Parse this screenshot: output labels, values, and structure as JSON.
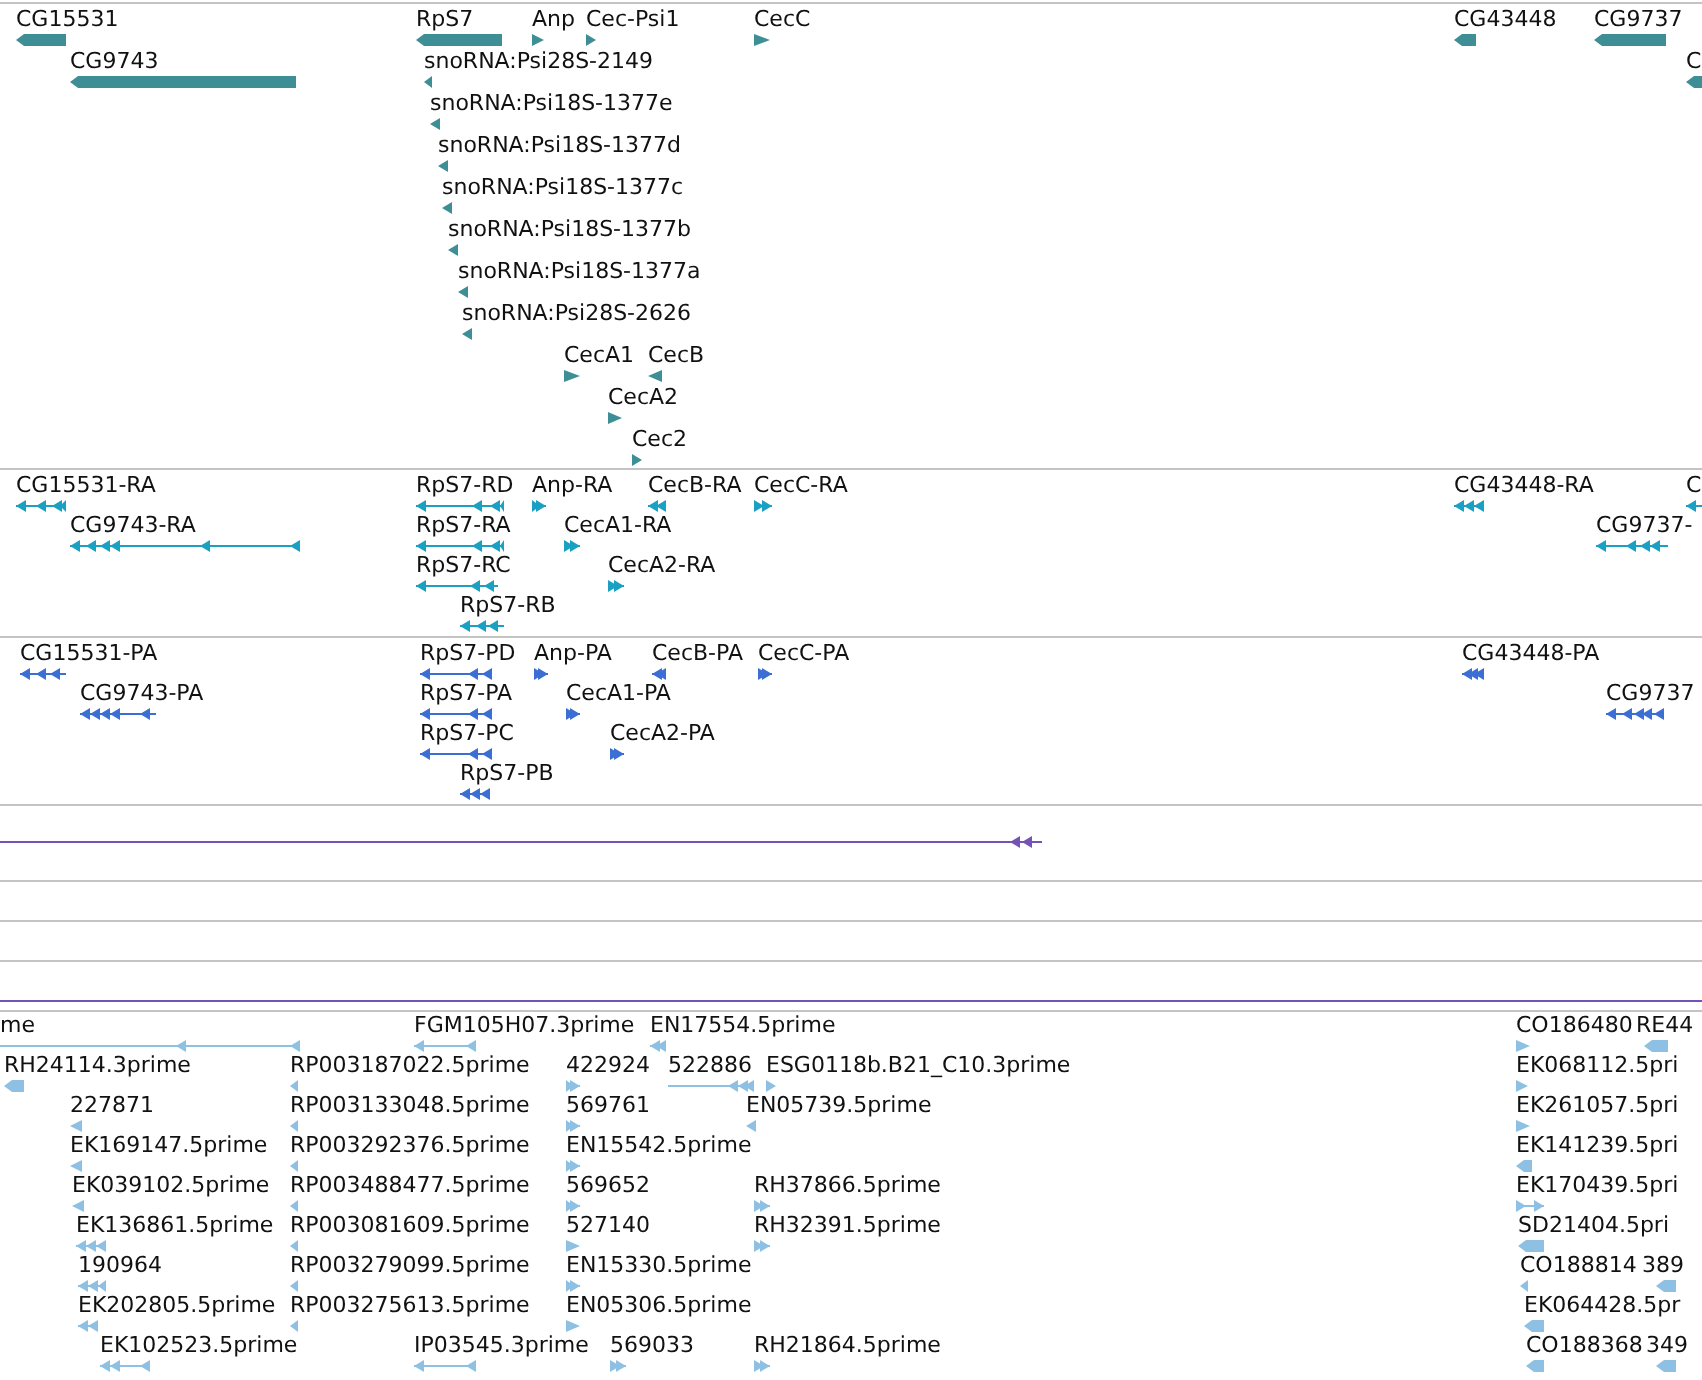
{
  "tracks": [
    {
      "color": "#3d8f95",
      "features": [
        {
          "label": "CG15531",
          "reverse": true
        },
        {
          "label": "CG9743",
          "reverse": true
        },
        {
          "label": "RpS7",
          "reverse": true
        },
        {
          "label": "Anp",
          "reverse": false
        },
        {
          "label": "Cec-Psi1",
          "reverse": false
        },
        {
          "label": "CecC",
          "reverse": false
        },
        {
          "label": "snoRNA:Psi28S-2149",
          "reverse": true
        },
        {
          "label": "snoRNA:Psi18S-1377e",
          "reverse": true
        },
        {
          "label": "snoRNA:Psi18S-1377d",
          "reverse": true
        },
        {
          "label": "snoRNA:Psi18S-1377c",
          "reverse": true
        },
        {
          "label": "snoRNA:Psi18S-1377b",
          "reverse": true
        },
        {
          "label": "snoRNA:Psi18S-1377a",
          "reverse": true
        },
        {
          "label": "snoRNA:Psi28S-2626",
          "reverse": true
        },
        {
          "label": "CecA1",
          "reverse": false
        },
        {
          "label": "CecB",
          "reverse": true
        },
        {
          "label": "CecA2",
          "reverse": false
        },
        {
          "label": "Cec2",
          "reverse": false
        },
        {
          "label": "CG43448",
          "reverse": true
        },
        {
          "label": "CG9737",
          "reverse": true
        },
        {
          "label": "C",
          "reverse": true
        }
      ]
    },
    {
      "color": "#1aa0c3",
      "features": [
        {
          "label": "CG15531-RA",
          "reverse": true
        },
        {
          "label": "CG9743-RA",
          "reverse": true
        },
        {
          "label": "RpS7-RD",
          "reverse": true
        },
        {
          "label": "Anp-RA",
          "reverse": false
        },
        {
          "label": "CecB-RA",
          "reverse": true
        },
        {
          "label": "CecC-RA",
          "reverse": false
        },
        {
          "label": "RpS7-RA",
          "reverse": true
        },
        {
          "label": "CecA1-RA",
          "reverse": false
        },
        {
          "label": "RpS7-RC",
          "reverse": true
        },
        {
          "label": "CecA2-RA",
          "reverse": false
        },
        {
          "label": "RpS7-RB",
          "reverse": true
        },
        {
          "label": "CG43448-RA",
          "reverse": true
        },
        {
          "label": "CG9737-",
          "reverse": true
        },
        {
          "label": "C",
          "reverse": true
        }
      ]
    },
    {
      "color": "#3b6fd4",
      "features": [
        {
          "label": "CG15531-PA",
          "reverse": true
        },
        {
          "label": "CG9743-PA",
          "reverse": true
        },
        {
          "label": "RpS7-PD",
          "reverse": true
        },
        {
          "label": "Anp-PA",
          "reverse": false
        },
        {
          "label": "CecB-PA",
          "reverse": true
        },
        {
          "label": "CecC-PA",
          "reverse": false
        },
        {
          "label": "RpS7-PA",
          "reverse": true
        },
        {
          "label": "CecA1-PA",
          "reverse": false
        },
        {
          "label": "RpS7-PC",
          "reverse": true
        },
        {
          "label": "CecA2-PA",
          "reverse": false
        },
        {
          "label": "RpS7-PB",
          "reverse": true
        },
        {
          "label": "CG43448-PA",
          "reverse": true
        },
        {
          "label": "CG9737",
          "reverse": true
        }
      ]
    },
    {
      "color": "#7553b5",
      "features": [
        {
          "reverse": true
        }
      ]
    },
    {
      "color": "#8ec0e3",
      "features": [
        {
          "label": "me",
          "reverse": true
        },
        {
          "label": "FGM105H07.3prime",
          "reverse": true
        },
        {
          "label": "EN17554.5prime",
          "reverse": true
        },
        {
          "label": "CO186480",
          "reverse": false
        },
        {
          "label": "RE44",
          "reverse": true
        },
        {
          "label": "RH24114.3prime",
          "reverse": true
        },
        {
          "label": "RP003187022.5prime",
          "reverse": true
        },
        {
          "label": "422924",
          "reverse": false
        },
        {
          "label": "522886",
          "reverse": true
        },
        {
          "label": "ESG0118b.B21_C10.3prime",
          "reverse": false
        },
        {
          "label": "EK068112.5pri",
          "reverse": false
        },
        {
          "label": "227871",
          "reverse": true
        },
        {
          "label": "RP003133048.5prime",
          "reverse": true
        },
        {
          "label": "569761",
          "reverse": false
        },
        {
          "label": "EN05739.5prime",
          "reverse": true
        },
        {
          "label": "EK261057.5pri",
          "reverse": false
        },
        {
          "label": "EK169147.5prime",
          "reverse": true
        },
        {
          "label": "RP003292376.5prime",
          "reverse": true
        },
        {
          "label": "EN15542.5prime",
          "reverse": false
        },
        {
          "label": "EK141239.5pri",
          "reverse": true
        },
        {
          "label": "EK039102.5prime",
          "reverse": true
        },
        {
          "label": "RP003488477.5prime",
          "reverse": true
        },
        {
          "label": "569652",
          "reverse": false
        },
        {
          "label": "RH37866.5prime",
          "reverse": false
        },
        {
          "label": "EK170439.5pri",
          "reverse": false
        },
        {
          "label": "EK136861.5prime",
          "reverse": true
        },
        {
          "label": "RP003081609.5prime",
          "reverse": true
        },
        {
          "label": "527140",
          "reverse": false
        },
        {
          "label": "RH32391.5prime",
          "reverse": false
        },
        {
          "label": "SD21404.5pri",
          "reverse": true
        },
        {
          "label": "190964",
          "reverse": true
        },
        {
          "label": "RP003279099.5prime",
          "reverse": true
        },
        {
          "label": "EN15330.5prime",
          "reverse": false
        },
        {
          "label": "CO188814",
          "reverse": true
        },
        {
          "label": "389",
          "reverse": true
        },
        {
          "label": "EK202805.5prime",
          "reverse": true
        },
        {
          "label": "RP003275613.5prime",
          "reverse": true
        },
        {
          "label": "EN05306.5prime",
          "reverse": false
        },
        {
          "label": "EK064428.5pr",
          "reverse": true
        },
        {
          "label": "EK102523.5prime",
          "reverse": true
        },
        {
          "label": "IP03545.3prime",
          "reverse": true
        },
        {
          "label": "569033",
          "reverse": false
        },
        {
          "label": "RH21864.5prime",
          "reverse": false
        },
        {
          "label": "CO188368",
          "reverse": true
        },
        {
          "label": "349",
          "reverse": true
        }
      ]
    }
  ]
}
